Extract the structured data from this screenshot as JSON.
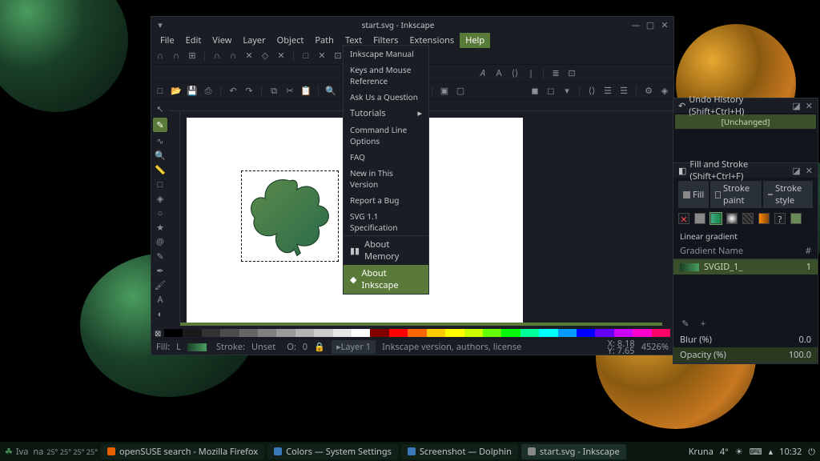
{
  "title": "start.svg - Inkscape",
  "menu": {
    "file": "File",
    "edit": "Edit",
    "view": "View",
    "layer": "Layer",
    "object": "Object",
    "path": "Path",
    "text": "Text",
    "filters": "Filters",
    "extensions": "Extensions",
    "help": "Help"
  },
  "help_menu": {
    "manual": "Inkscape Manual",
    "keys": "Keys and Mouse Reference",
    "ask": "Ask Us a Question",
    "tutorials": "Tutorials",
    "cmdline": "Command Line Options",
    "faq": "FAQ",
    "new": "New in This Version",
    "report": "Report a Bug",
    "svg": "SVG 1.1 Specification",
    "memory": "About Memory",
    "about": "About Inkscape"
  },
  "panels": {
    "undo_title": "Undo History (Shift+Ctrl+H)",
    "unchanged": "[Unchanged]",
    "fillstroke_title": "Fill and Stroke (Shift+Ctrl+F)",
    "tab_fill": "Fill",
    "tab_strokepaint": "Stroke paint",
    "tab_strokestyle": "Stroke style",
    "lineargrad": "Linear gradient",
    "col_gradient": "Gradient",
    "col_name": "Name",
    "col_hash": "#",
    "grad_name": "SVGID_1_",
    "grad_count": "1",
    "blur_label": "Blur (%)",
    "blur_val": "0.0",
    "opacity_label": "Opacity (%)",
    "opacity_val": "100.0"
  },
  "status": {
    "fill_label": "Fill:",
    "stroke_label": "Stroke:",
    "stroke_val": "Unset",
    "o_label": "O:",
    "o_val": "0",
    "layer": "Layer 1",
    "hint": "Inkscape version, authors, license",
    "x_label": "X:",
    "x_val": "8.18",
    "y_label": "Y:",
    "y_val": "7.65",
    "zoom": "4526%",
    "l_label": "L"
  },
  "taskbar": {
    "user": "Iva",
    "na": "na",
    "temps": "25° 25° 25° 25°",
    "t1": "openSUSE search - Mozilla Firefox",
    "t2": "Colors — System Settings",
    "t3": "Screenshot — Dolphin",
    "t4": "start.svg - Inkscape",
    "loc": "Kruna",
    "temp": "4°",
    "clock": "10:32"
  },
  "palette": [
    "#000000",
    "#1a1a1a",
    "#333333",
    "#4d4d4d",
    "#666666",
    "#808080",
    "#999999",
    "#b3b3b3",
    "#cccccc",
    "#e6e6e6",
    "#ffffff",
    "#800000",
    "#ff0000",
    "#ff6600",
    "#ffcc00",
    "#ffff00",
    "#ccff00",
    "#66ff00",
    "#00ff00",
    "#00ff99",
    "#00ffff",
    "#0099ff",
    "#0000ff",
    "#6600ff",
    "#cc00ff",
    "#ff00cc",
    "#ff0066"
  ]
}
